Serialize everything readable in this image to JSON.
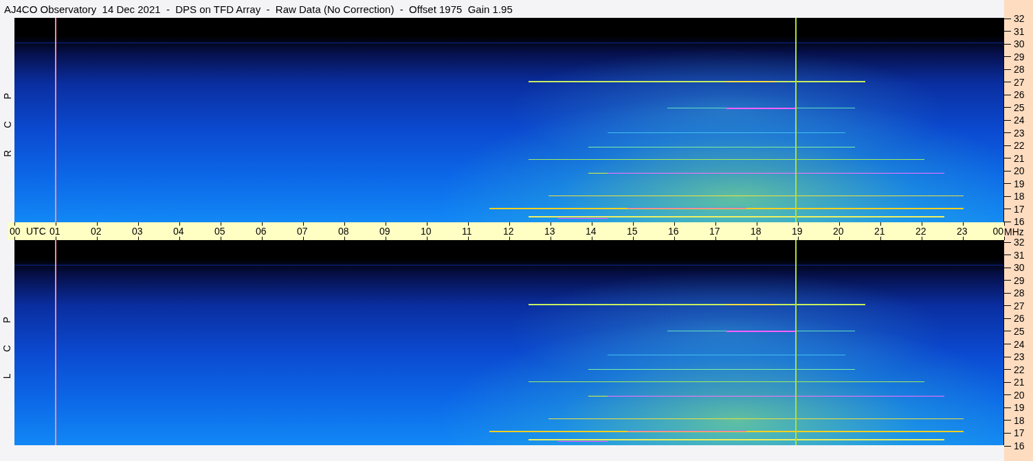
{
  "title": "AJ4CO Observatory  14 Dec 2021  -  DPS on TFD Array  -  Raw Data (No Correction)  -  Offset 1975  Gain 1.95",
  "panels": [
    {
      "label": "R C P",
      "frequency_ticks": [
        "32",
        "31",
        "30",
        "29",
        "28",
        "27",
        "26",
        "25",
        "24",
        "23",
        "22",
        "21",
        "20",
        "19",
        "18",
        "17",
        "16"
      ]
    },
    {
      "label": "L C P",
      "frequency_ticks": [
        "32",
        "31",
        "30",
        "29",
        "28",
        "27",
        "26",
        "25",
        "24",
        "23",
        "22",
        "21",
        "20",
        "19",
        "18",
        "17",
        "16"
      ]
    }
  ],
  "time_axis": {
    "labels": [
      "00",
      "01",
      "02",
      "03",
      "04",
      "05",
      "06",
      "07",
      "08",
      "09",
      "10",
      "11",
      "12",
      "13",
      "14",
      "15",
      "16",
      "17",
      "18",
      "19",
      "20",
      "21",
      "22",
      "23",
      "00"
    ],
    "zone": "UTC",
    "unit": "MHz"
  }
}
